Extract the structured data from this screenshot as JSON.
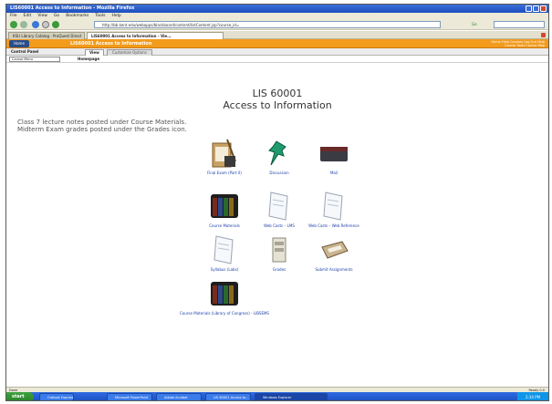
{
  "window": {
    "title": "LIS60001 Access to Information - Mozilla Firefox"
  },
  "menubar": [
    "File",
    "Edit",
    "View",
    "Go",
    "Bookmarks",
    "Tools",
    "Help"
  ],
  "address_bar": {
    "url": "http://bb.kent.edu/webapps/blackboard/content/listContent.jsp?course_id=",
    "go_label": "Go"
  },
  "browser_tabs": [
    {
      "label": "KSU Library Catalog - ProQuest Direct"
    },
    {
      "label": "LIS60001 Access to Information - Vie..."
    }
  ],
  "bb_header": {
    "menu_button": "Home",
    "course_title": "LIS60001 Access to Information",
    "top_links": "Home  Help  Courses  Log Out  Help\nCourse Tools  Course Map"
  },
  "control_row": {
    "control_panel": "Control Panel",
    "view_tab": "View",
    "options_tab": "Customize Options"
  },
  "crumb_row": {
    "course_menu": "Course Menu",
    "crumb": "Homepage"
  },
  "content": {
    "course_code": "LIS 60001",
    "course_name": "Access to Information",
    "announcement": "Class 7 lecture notes posted under Course Materials.\nMidterm Exam grades posted under the Grades icon."
  },
  "tiles": [
    {
      "label": "Final Exam (Part II)",
      "icon": "exam-icon"
    },
    {
      "label": "Discussion",
      "icon": "pushpin-icon"
    },
    {
      "label": "Mail",
      "icon": "mailbox-icon"
    },
    {
      "label": "Course Materials",
      "icon": "binders-icon"
    },
    {
      "label": "Web Casts – LMS",
      "icon": "paper-icon"
    },
    {
      "label": "Web Casts – Web Reference",
      "icon": "paper-icon"
    },
    {
      "label": "Syllabus (Labs)",
      "icon": "paper-icon"
    },
    {
      "label": "Grades",
      "icon": "ledger-icon"
    },
    {
      "label": "Submit Assignments",
      "icon": "tray-icon"
    },
    {
      "label": "Course Materials (Library of Congress) - LIBSEMS",
      "icon": "binders-icon"
    }
  ],
  "statusbar": {
    "text": "Done",
    "right": "Ready  0.0"
  },
  "taskbar": {
    "start": "start",
    "items": [
      "Outlook Express",
      "Microsoft PowerPoint",
      "Adobe Acrobat",
      "LIS 60001 Access to...",
      "Windows Explorer"
    ],
    "clock": "2:34 PM"
  }
}
